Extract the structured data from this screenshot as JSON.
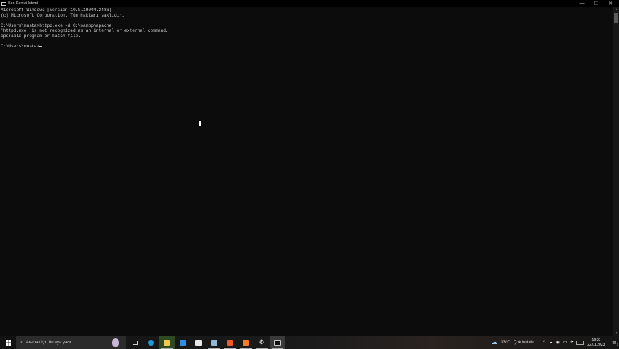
{
  "window": {
    "title": "Seç Komut İstemi",
    "minimize": "—",
    "restore": "❐",
    "close": "✕"
  },
  "terminal": {
    "lines": [
      "Microsoft Windows [Version 10.0.19044.2486]",
      "(c) Microsoft Corporation. Tüm hakları saklıdır.",
      "",
      "C:\\Users\\musta>httpd.exe -d C:\\xampp\\apache",
      "'httpd.exe' is not recognized as an internal or external command,",
      "operable program or batch file.",
      "",
      "C:\\Users\\musta>"
    ]
  },
  "taskbar": {
    "search_placeholder": "Aramak için buraya yazın",
    "apps": [
      {
        "name": "task-view",
        "color": "#cccccc"
      },
      {
        "name": "edge",
        "color": "#1e9bd7"
      },
      {
        "name": "file-explorer",
        "color": "#f2c94c"
      },
      {
        "name": "mail",
        "color": "#2f8de4"
      },
      {
        "name": "store",
        "color": "#e8e8e8"
      },
      {
        "name": "notepad",
        "color": "#8fb7d8"
      },
      {
        "name": "brave",
        "color": "#f05a24"
      },
      {
        "name": "xampp",
        "color": "#fb7a24"
      },
      {
        "name": "settings",
        "color": "#dddddd"
      },
      {
        "name": "command-prompt",
        "color": "#222222"
      }
    ],
    "weather": {
      "temp": "13°C",
      "condition": "Çok bulutlu"
    },
    "time": "19:38",
    "date": "22.01.2023",
    "notifications": "3"
  }
}
